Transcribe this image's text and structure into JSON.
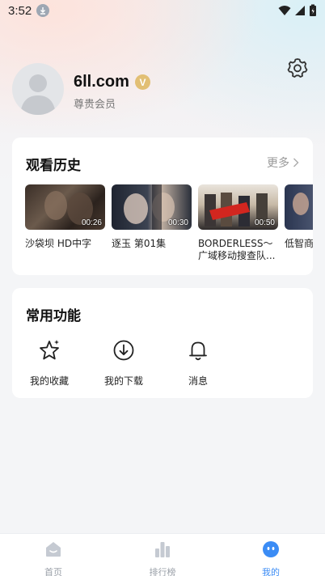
{
  "status": {
    "time": "3:52"
  },
  "profile": {
    "username": "6ll.com",
    "vip_mark": "V",
    "member_level": "尊贵会员"
  },
  "history": {
    "title": "观看历史",
    "more": "更多",
    "items": [
      {
        "title": "沙袋坝 HD中字",
        "duration": "00:26"
      },
      {
        "title": "逐玉 第01集",
        "duration": "00:30"
      },
      {
        "title": "BORDERLESS～广域移动搜查队...",
        "duration": "00:50"
      },
      {
        "title": "低智商犯罪 全集",
        "duration": ""
      }
    ]
  },
  "functions": {
    "title": "常用功能",
    "items": [
      {
        "label": "我的收藏",
        "icon": "star-icon"
      },
      {
        "label": "我的下载",
        "icon": "download-icon"
      },
      {
        "label": "消息",
        "icon": "bell-icon"
      }
    ]
  },
  "tabs": [
    {
      "label": "首页",
      "icon": "home-icon",
      "active": false
    },
    {
      "label": "排行榜",
      "icon": "ranking-icon",
      "active": false
    },
    {
      "label": "我的",
      "icon": "profile-icon",
      "active": true
    }
  ],
  "colors": {
    "accent": "#3b8cf5",
    "vip": "#e2bf74",
    "background": "#f4f5f7"
  }
}
